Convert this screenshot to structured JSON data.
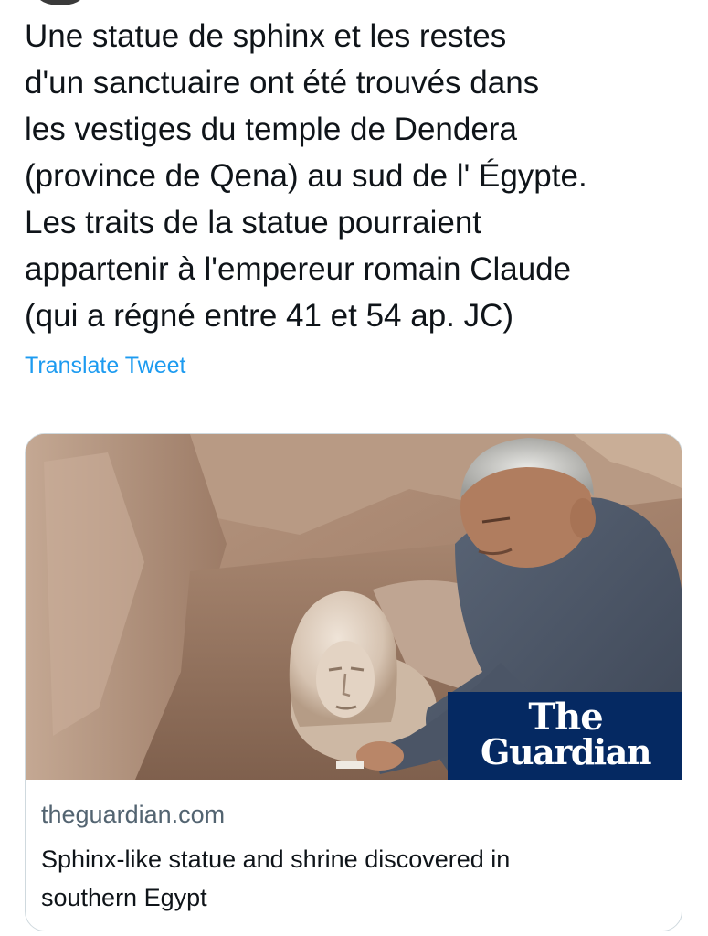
{
  "tweet": {
    "text_lines": [
      "Une statue de sphinx et les restes",
      "d'un sanctuaire ont été trouvés dans",
      "les vestiges du temple de Dendera",
      "(province de Qena) au sud de l' Égypte.",
      "Les traits de la statue pourraient",
      "appartenir à l'empereur romain Claude",
      "(qui a régné entre 41 et 54 ap. JC)"
    ],
    "translate_label": "Translate Tweet"
  },
  "card": {
    "image_logo": {
      "line1": "The",
      "line2": "Guardian"
    },
    "domain": "theguardian.com",
    "title_lines": [
      "Sphinx-like statue and shrine discovered in",
      "southern Egypt"
    ]
  },
  "colors": {
    "link": "#1d9bf0",
    "text": "#0f1419",
    "muted": "#536471",
    "card_border": "#cfd9de",
    "guardian_blue": "#052962"
  }
}
